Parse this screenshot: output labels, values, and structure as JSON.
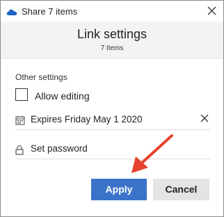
{
  "titlebar": {
    "title": "Share 7 items",
    "app_icon": "onedrive-cloud-icon",
    "close_icon": "close-icon"
  },
  "header": {
    "title": "Link settings",
    "subtitle": "7 Items"
  },
  "settings": {
    "section_label": "Other settings",
    "allow_editing": {
      "label": "Allow editing",
      "checked": false
    },
    "expires": {
      "label": "Expires Friday May 1 2020",
      "icon": "calendar-icon",
      "clear_icon": "close-icon"
    },
    "password": {
      "label": "Set password",
      "icon": "lock-icon"
    }
  },
  "buttons": {
    "apply": "Apply",
    "cancel": "Cancel"
  },
  "colors": {
    "accent": "#3b73c9",
    "annotation_arrow": "#e8432e",
    "header_bg": "#f3f3f3"
  }
}
